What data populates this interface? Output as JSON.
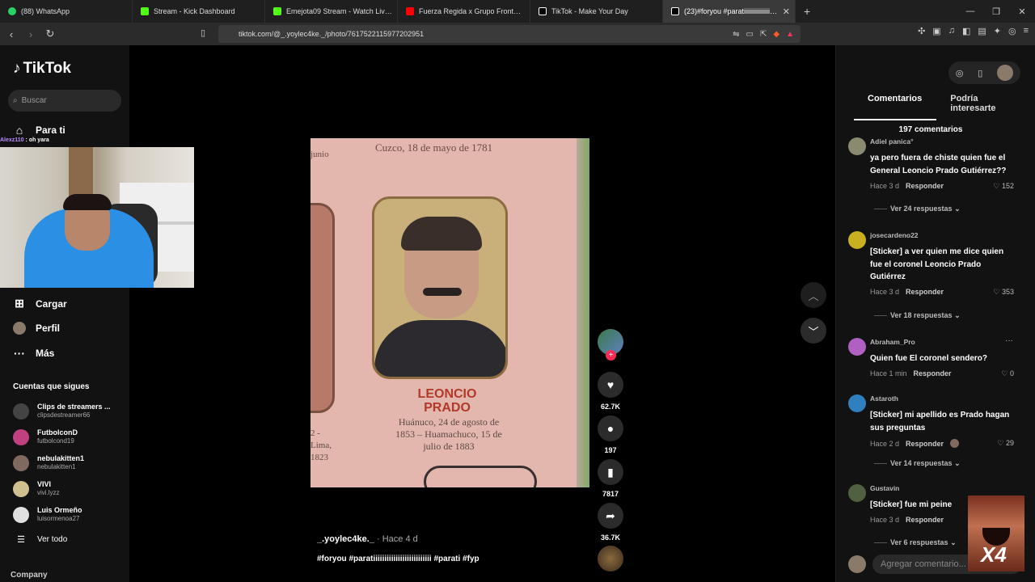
{
  "browser": {
    "tabs": [
      {
        "label": "(88) WhatsApp",
        "color": "#25d366",
        "active": false
      },
      {
        "label": "Stream - Kick Dashboard",
        "color": "#53fc18",
        "active": false
      },
      {
        "label": "Emejota09 Stream - Watch Live on Ki",
        "color": "#53fc18",
        "active": false
      },
      {
        "label": "Fuerza Regida x Grupo Frontera - Bel",
        "color": "#ff0000",
        "active": false
      },
      {
        "label": "TikTok - Make Your Day",
        "color": "#ffffff",
        "active": false
      },
      {
        "label": "(23)#foryou #paratiiiiiiiiiiiiiiiiiiiii",
        "color": "#ffffff",
        "active": true
      }
    ],
    "url": "tiktok.com/@_.yoylec4ke._/photo/7617522115977202951"
  },
  "sidebar": {
    "logo": "TikTok",
    "search_placeholder": "Buscar",
    "nav": {
      "foryou": "Para ti",
      "upload": "Cargar",
      "profile": "Perfil",
      "more": "Más"
    },
    "chat": {
      "user": "Alexz110",
      "message": " : oh yara"
    },
    "following_title": "Cuentas que sigues",
    "following": [
      {
        "name": "Clips de streamers ...",
        "handle": "clipsdestreamer66",
        "color": "#444444"
      },
      {
        "name": "FutbolconD",
        "handle": "futbolcond19",
        "color": "#c04080"
      },
      {
        "name": "nebulakitten1",
        "handle": "nebulakitten1",
        "color": "#806a60"
      },
      {
        "name": "VIVI",
        "handle": "vivi.lyzz",
        "color": "#d0c090"
      },
      {
        "name": "Luis Ormeño",
        "handle": "luisormenoa27",
        "color": "#e0e0e0"
      }
    ],
    "see_all": "Ver todo",
    "company": "Company"
  },
  "photo": {
    "date_text": "Cuzco, 18 de mayo de 1781",
    "partial_left": "junio",
    "name": "LEONCIO PRADO",
    "born": "Huánuco, 24 de agosto de 1853 – Huamachuco, 15 de julio de 1883",
    "lima": "2 - Lima, 1823"
  },
  "actions": {
    "likes": "62.7K",
    "comments": "197",
    "saves": "7817",
    "shares": "36.7K"
  },
  "caption": {
    "user": "_.yoylec4ke._",
    "ago": " · Hace 4 d",
    "text": "#foryou #paratiiiiiiiiiiiiiiiiiiiiiiiiii #parati #fyp"
  },
  "panel": {
    "tab_comments": "Comentarios",
    "tab_interest": "Podría interesarte",
    "count": "197 comentarios",
    "reply_label": "Responder",
    "comments": [
      {
        "user": "Adiel panica°",
        "text": "ya pero fuera de chiste quien fue el General Leoncio Prado Gutiérrez??",
        "time": "Hace 3 d",
        "likes": "152",
        "replies": "Ver 24 respuestas",
        "color": "#8a8a70"
      },
      {
        "user": "josecardeno22",
        "text": "[Sticker] a ver quien me dice quien fue el coronel Leoncio Prado Gutiérrez",
        "time": "Hace 3 d",
        "likes": "353",
        "replies": "Ver 18 respuestas",
        "color": "#c8b020"
      },
      {
        "user": "Abraham_Pro",
        "text": "Quien fue El coronel sendero?",
        "time": "Hace 1 min",
        "likes": "0",
        "replies": "",
        "color": "#b060c0"
      },
      {
        "user": "Astaroth",
        "text": "[Sticker] mi apellido es Prado hagan sus preguntas",
        "time": "Hace 2 d",
        "likes": "29",
        "replies": "Ver 14 respuestas",
        "color": "#3080c0"
      },
      {
        "user": "Gustavin",
        "text": "[Sticker] fue mi peine",
        "time": "Hace 3 d",
        "likes": "",
        "replies": "Ver 6 respuestas",
        "color": "#506040"
      }
    ],
    "add_placeholder": "Agregar comentario...",
    "overlay_text": "X4"
  }
}
